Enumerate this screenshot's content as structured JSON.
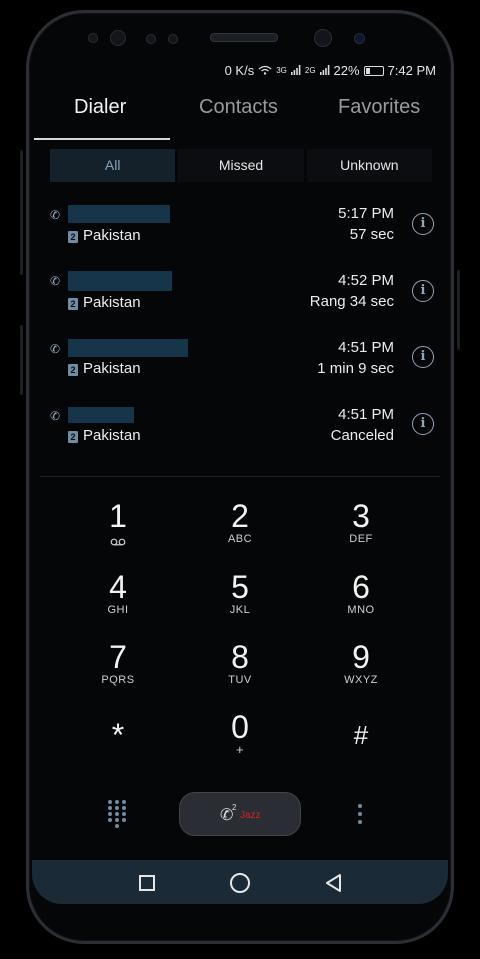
{
  "status_bar": {
    "speed": "0 K/s",
    "net1": "3G",
    "net2": "2G",
    "battery": "22%",
    "time": "7:42 PM"
  },
  "tabs": [
    {
      "label": "Dialer"
    },
    {
      "label": "Contacts"
    },
    {
      "label": "Favorites"
    }
  ],
  "filters": [
    {
      "label": "All"
    },
    {
      "label": "Missed"
    },
    {
      "label": "Unknown"
    }
  ],
  "call_log": [
    {
      "country": "Pakistan",
      "sim": "2",
      "time": "5:17 PM",
      "detail": "57 sec",
      "type_icon": "outgoing-call-icon"
    },
    {
      "country": "Pakistan",
      "sim": "2",
      "time": "4:52 PM",
      "detail": "Rang 34 sec",
      "type_icon": "missed-call-icon"
    },
    {
      "country": "Pakistan",
      "sim": "2",
      "time": "4:51 PM",
      "detail": "1 min 9 sec",
      "type_icon": "outgoing-call-icon"
    },
    {
      "country": "Pakistan",
      "sim": "2",
      "time": "4:51 PM",
      "detail": "Canceled",
      "type_icon": "outgoing-call-icon"
    }
  ],
  "keypad": [
    {
      "digit": "1",
      "letters": ""
    },
    {
      "digit": "2",
      "letters": "ABC"
    },
    {
      "digit": "3",
      "letters": "DEF"
    },
    {
      "digit": "4",
      "letters": "GHI"
    },
    {
      "digit": "5",
      "letters": "JKL"
    },
    {
      "digit": "6",
      "letters": "MNO"
    },
    {
      "digit": "7",
      "letters": "PQRS"
    },
    {
      "digit": "8",
      "letters": "TUV"
    },
    {
      "digit": "9",
      "letters": "WXYZ"
    },
    {
      "digit": "*",
      "letters": ""
    },
    {
      "digit": "0",
      "letters": "+"
    },
    {
      "digit": "#",
      "letters": ""
    }
  ],
  "call_button": {
    "sim": "2",
    "carrier": "Jazz"
  },
  "colors": {
    "accent": "#6f8ca3",
    "carrier": "#d92020",
    "navbar": "#1b2a37"
  }
}
